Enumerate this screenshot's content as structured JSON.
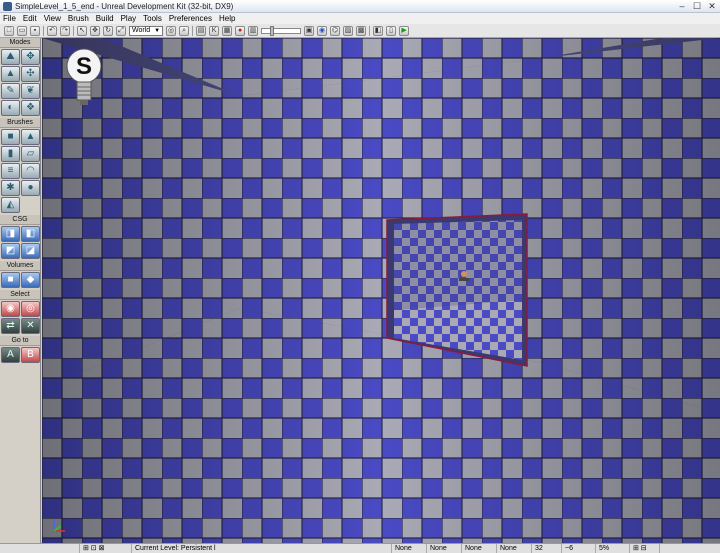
{
  "window": {
    "title": "SimpleLevel_1_5_end - Unreal Development Kit (32-bit, DX9)",
    "controls": [
      "–",
      "☐",
      "✕"
    ]
  },
  "menu": [
    "File",
    "Edit",
    "View",
    "Brush",
    "Build",
    "Play",
    "Tools",
    "Preferences",
    "Help"
  ],
  "toolbar": {
    "coordinate_system": "World",
    "icons": [
      "new-icon",
      "open-icon",
      "save-icon",
      "undo-icon",
      "redo-icon",
      "camera-icon",
      "select-icon",
      "translate-icon",
      "rotate-icon",
      "scale-icon",
      "search-icon",
      "binoculars-icon",
      "build-icon",
      "lighting-icon",
      "paths-icon",
      "build-all-icon",
      "play-icon"
    ]
  },
  "left_panel": {
    "sections": [
      {
        "label": "Modes",
        "buttons": [
          "camera-mode",
          "geometry-mode",
          "terrain-mode",
          "texture-mode",
          "paint-mode",
          "foliage-mode",
          "mesh-paint-mode",
          "landscape-mode"
        ]
      },
      {
        "label": "Brushes",
        "buttons": [
          "cube-brush",
          "cone-brush",
          "cylinder-brush",
          "sheet-brush",
          "stairs-brush",
          "curved-stairs-brush",
          "volumetric-brush",
          "sphere-brush",
          "tetrahedron-brush"
        ]
      },
      {
        "label": "CSG",
        "buttons": [
          "csg-add",
          "csg-subtract",
          "csg-intersect",
          "csg-deintersect"
        ]
      },
      {
        "label": "Volumes",
        "buttons": [
          "add-volume",
          "volume-list"
        ]
      },
      {
        "label": "Select",
        "buttons": [
          "show-selected",
          "hide-selected",
          "select-invert",
          "show-all"
        ]
      },
      {
        "label": "Go to",
        "buttons": [
          "go-to-actor",
          "go-to-builder-brush"
        ]
      }
    ]
  },
  "viewport": {
    "overlay_letter": "S",
    "floor_color": "#4c4cc8",
    "tile_light": "#a8a8b4"
  },
  "statusbar": {
    "current_level": "Current Level:  Persistent l",
    "fields": [
      "None",
      "None",
      "None",
      "None"
    ],
    "grid_size": "32",
    "rotation_snap": "~6",
    "scale_snap": "5%"
  }
}
